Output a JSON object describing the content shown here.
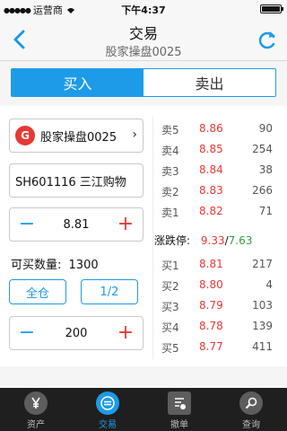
{
  "status_bar": {
    "carrier": "运营商",
    "time": "下午4:37"
  },
  "header": {
    "title": "交易",
    "subtitle": "股家操盘0025"
  },
  "segment": {
    "buy": "买入",
    "sell": "卖出"
  },
  "form": {
    "account_logo": "G",
    "account": "股家操盘0025",
    "stock": "SH601116  三江购物",
    "price": "8.81",
    "price_minus": "−",
    "price_plus": "+",
    "available_label": "可买数量:",
    "available_value": "1300",
    "all_button": "全仓",
    "half_button": "1/2",
    "quantity": "200",
    "qty_minus": "−",
    "qty_plus": "+"
  },
  "order_book": {
    "asks": [
      {
        "label": "卖5",
        "price": "8.86",
        "volume": "90"
      },
      {
        "label": "卖4",
        "price": "8.85",
        "volume": "254"
      },
      {
        "label": "卖3",
        "price": "8.84",
        "volume": "38"
      },
      {
        "label": "卖2",
        "price": "8.83",
        "volume": "266"
      },
      {
        "label": "卖1",
        "price": "8.82",
        "volume": "71"
      }
    ],
    "limit_label": "涨跌停:",
    "limit_up": "9.33",
    "limit_sep": "/",
    "limit_down": "7.63",
    "bids": [
      {
        "label": "买1",
        "price": "8.81",
        "volume": "217"
      },
      {
        "label": "买2",
        "price": "8.80",
        "volume": "4"
      },
      {
        "label": "买3",
        "price": "8.79",
        "volume": "103"
      },
      {
        "label": "买4",
        "price": "8.78",
        "volume": "139"
      },
      {
        "label": "买5",
        "price": "8.77",
        "volume": "411"
      }
    ]
  },
  "tabs": [
    {
      "label": "资产",
      "icon": "yen-icon"
    },
    {
      "label": "交易",
      "icon": "trade-icon"
    },
    {
      "label": "撤单",
      "icon": "cancel-order-icon"
    },
    {
      "label": "查询",
      "icon": "search-icon"
    }
  ],
  "colors": {
    "accent": "#1d9be8",
    "up": "#e53935",
    "down": "#2e9e41"
  }
}
